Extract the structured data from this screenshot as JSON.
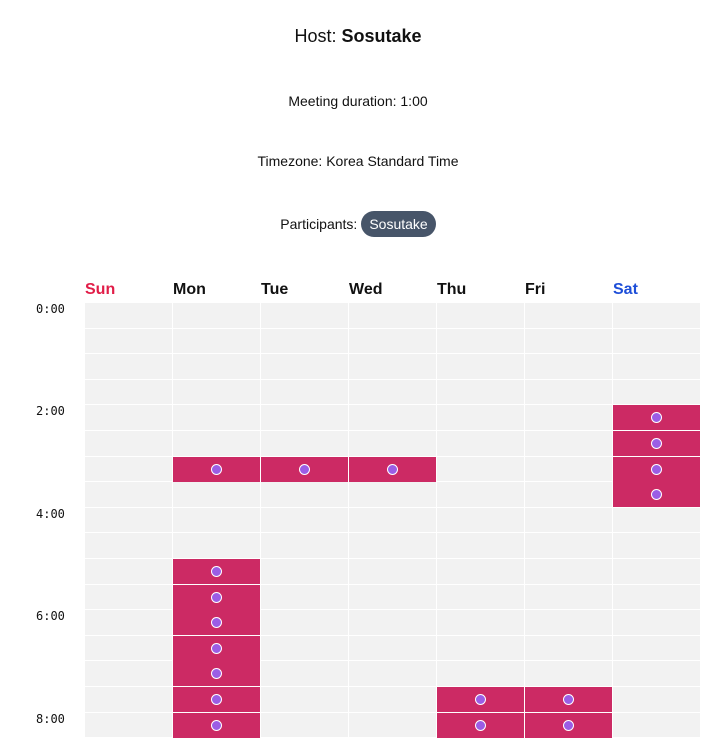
{
  "header": {
    "host_label": "Host:",
    "host_name": "Sosutake",
    "duration": "Meeting duration: 1:00",
    "timezone": "Timezone: Korea Standard Time",
    "participants_label": "Participants:",
    "participants": [
      "Sosutake"
    ]
  },
  "colors": {
    "sunday": "#e11d48",
    "saturday": "#1d4ed8",
    "weekday": "#111111",
    "available_slot": "#cc2a64",
    "slot_dot": "#9b5de5",
    "chip": "#475569",
    "grid_bg": "#f2f2f2"
  },
  "days": [
    "Sun",
    "Mon",
    "Tue",
    "Wed",
    "Thu",
    "Fri",
    "Sat"
  ],
  "time_labels": [
    "0:00",
    "2:00",
    "4:00",
    "6:00",
    "8:00"
  ],
  "available_slots": [
    {
      "day": "Mon",
      "times": [
        "3:00",
        "5:00",
        "5:30",
        "6:00",
        "6:30",
        "7:00",
        "7:30",
        "8:00"
      ]
    },
    {
      "day": "Tue",
      "times": [
        "3:00"
      ]
    },
    {
      "day": "Wed",
      "times": [
        "3:00"
      ]
    },
    {
      "day": "Thu",
      "times": [
        "7:30",
        "8:00"
      ]
    },
    {
      "day": "Fri",
      "times": [
        "7:30",
        "8:00"
      ]
    },
    {
      "day": "Sat",
      "times": [
        "2:00",
        "2:30",
        "3:00",
        "3:30"
      ]
    }
  ]
}
